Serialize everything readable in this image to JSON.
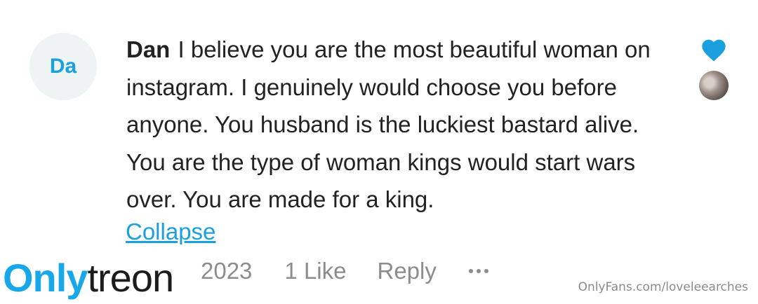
{
  "comment": {
    "avatar_initials": "Da",
    "author": "Dan",
    "text": "I believe you are the most beautiful woman on instagram. I genuinely would choose you be­fore anyone. You husband is the luckiest bas­tard alive. You are the type of woman kings would start wars over. You are made for a king.",
    "collapse_label": "Collapse",
    "date": "2023",
    "likes": "1 Like",
    "reply_label": "Reply",
    "liked": true,
    "heart_color": "#1ba0df"
  },
  "watermark": {
    "logo_part1": "Only",
    "logo_part2": "treon",
    "url": "OnlyFans.com/loveleearches"
  },
  "icons": [
    "heart-icon",
    "more-options-icon"
  ]
}
